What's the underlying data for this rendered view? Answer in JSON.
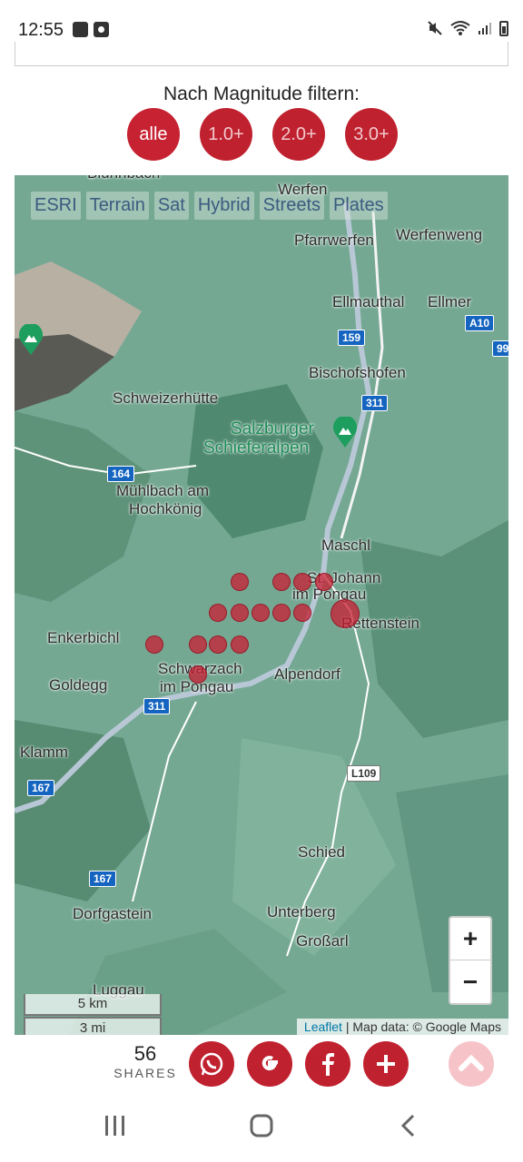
{
  "status": {
    "time": "12:55"
  },
  "filter": {
    "label": "Nach Magnitude filtern:",
    "buttons": [
      "alle",
      "1.0+",
      "2.0+",
      "3.0+"
    ]
  },
  "map": {
    "layers": [
      "ESRI",
      "Terrain",
      "Sat",
      "Hybrid",
      "Streets",
      "Plates"
    ],
    "places": {
      "werfen": "Werfen",
      "pfarrwerfen": "Pfarrwerfen",
      "werfenweng": "Werfenweng",
      "ellmauthal": "Ellmauthal",
      "ellmer": "Ellmer",
      "bischofshofen": "Bischofshofen",
      "schweizerhuette": "Schweizerhütte",
      "salzburger": "Salzburger",
      "schieferalpen": "Schieferalpen",
      "muehlbach": "Mühlbach am",
      "hochkoenig": "Hochkönig",
      "maschl": "Maschl",
      "stjohann1": "St. Johann",
      "stjohann2": "im Pongau",
      "rettenstein": "Rettenstein",
      "enkerbichl": "Enkerbichl",
      "schwarzach1": "Schwarzach",
      "schwarzach2": "im Pongau",
      "goldegg": "Goldegg",
      "alpendorf": "Alpendorf",
      "klamm": "Klamm",
      "schied": "Schied",
      "dorfgastein": "Dorfgastein",
      "unterberg": "Unterberg",
      "grossarl": "Großarl",
      "luggau": "Luggau",
      "bluehnbach": "Blühnbach"
    },
    "roads": {
      "a10": "A10",
      "r159": "159",
      "r99": "99",
      "r311a": "311",
      "r311b": "311",
      "r164": "164",
      "r167a": "167",
      "r167b": "167",
      "l109": "L109"
    },
    "zoom_in": "+",
    "zoom_out": "−",
    "scale_km": "5 km",
    "scale_mi": "3 mi",
    "attribution_link": "Leaflet",
    "attribution_text": " | Map data: © Google Maps"
  },
  "share": {
    "count": "56",
    "label": "SHARES"
  },
  "colors": {
    "accent": "#c0212f",
    "map_green": "#6fa48e"
  }
}
